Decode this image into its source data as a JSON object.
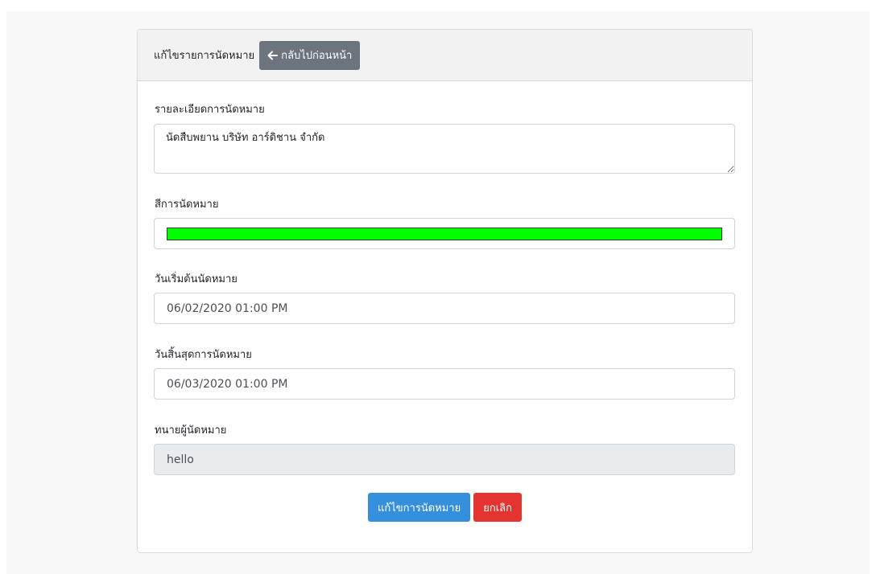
{
  "header": {
    "title": "แก้ไขรายการนัดหมาย",
    "back_label": "กลับไปก่อนหน้า"
  },
  "form": {
    "details": {
      "label": "รายละเอียดการนัดหมาย",
      "value": "นัดสืบพยาน บริษัท อาร์ดิชาน จำกัด"
    },
    "color": {
      "label": "สีการนัดหมาย",
      "value": "#00ff00"
    },
    "start": {
      "label": "วันเริ่มต้นนัดหมาย",
      "value": "06/02/2020 01:00 PM"
    },
    "end": {
      "label": "วันสิ้นสุดการนัดหมาย",
      "value": "06/03/2020 01:00 PM"
    },
    "lawyer": {
      "label": "ทนายผู้นัดหมาย",
      "value": "hello"
    }
  },
  "actions": {
    "submit_label": "แก้ไขการนัดหมาย",
    "cancel_label": "ยกเลิก"
  }
}
